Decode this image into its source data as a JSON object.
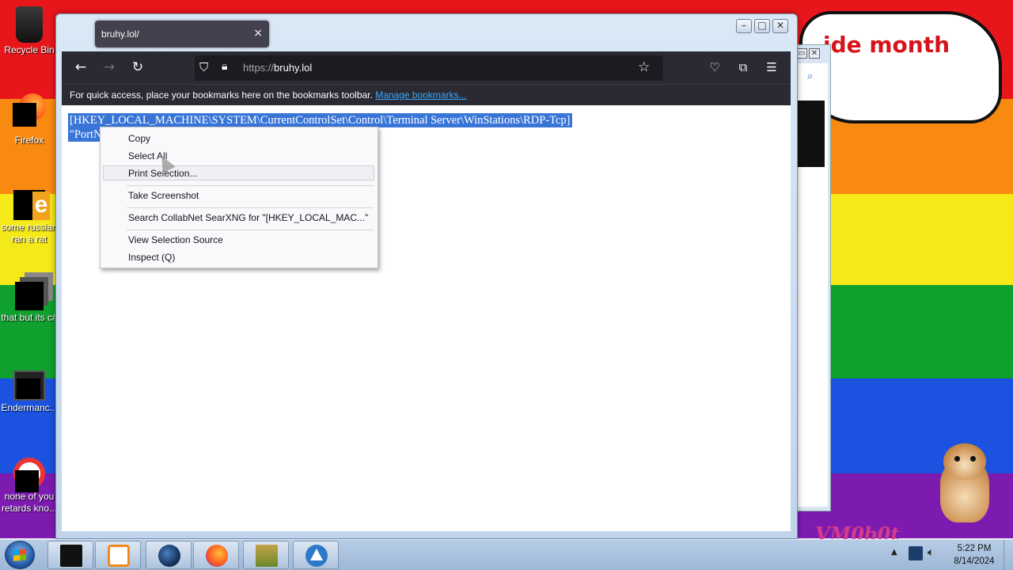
{
  "desktop": {
    "bubble_text": "ide month",
    "corner_text": "VM0b0t",
    "icons": [
      {
        "label": "Recycle Bin"
      },
      {
        "label": "Firefox"
      },
      {
        "label": "some russian ran a rat"
      },
      {
        "label": "that but its c#"
      },
      {
        "label": "Endermanc..."
      },
      {
        "label": "none of you retards kno..."
      }
    ]
  },
  "browser": {
    "tab_title": "bruhy.lol/",
    "tab_close": "×",
    "nav": {
      "back": "←",
      "forward": "→",
      "reload": "↻"
    },
    "url_scheme": "https://",
    "url_host": "bruhy.lol",
    "bookmarks_message": "For quick access, place your bookmarks here on the bookmarks toolbar.",
    "bookmarks_link": "Manage bookmarks...",
    "window_buttons": {
      "minimize": "–",
      "maximize": "□",
      "close": "✕"
    }
  },
  "page": {
    "selected_line1": "[HKEY_LOCAL_MACHINE\\SYSTEM\\CurrentControlSet\\Control\\Terminal Server\\WinStations\\RDP-Tcp]",
    "selected_line2": "\"PortN"
  },
  "context_menu": {
    "items": [
      "Copy",
      "Select All",
      "Print Selection...",
      "Take Screenshot",
      "Search CollabNet SearXNG for \"[HKEY_LOCAL_MAC...\"",
      "View Selection Source",
      "Inspect (Q)"
    ],
    "hovered_index": 2
  },
  "taskbar": {
    "clock_time": "5:22 PM",
    "clock_date": "8/14/2024",
    "tray_arrow": "▲",
    "buttons": [
      "terminal-app",
      "media-player",
      "globe-app",
      "firefox",
      "virtualbox",
      "triangle-app"
    ]
  }
}
